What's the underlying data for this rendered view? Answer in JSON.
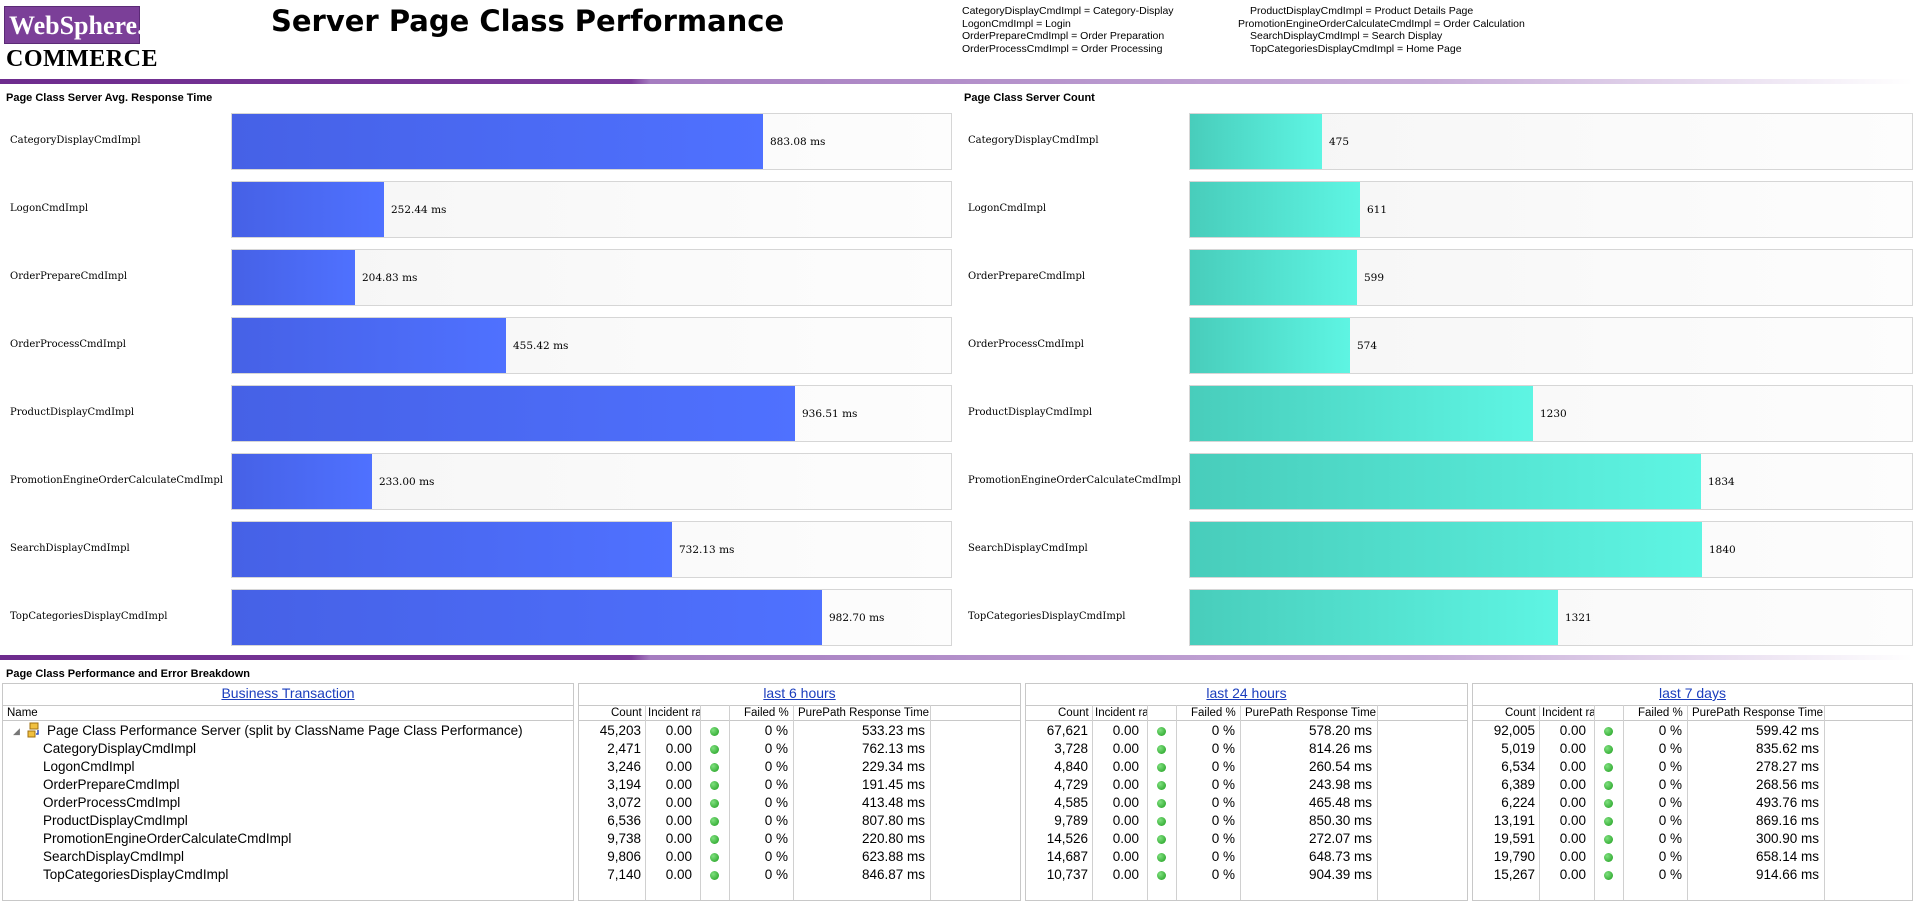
{
  "header": {
    "logo_top": "WebSphere.",
    "logo_bottom": "COMMERCE",
    "title": "Server Page Class Performance",
    "legend_col1": [
      "CategoryDisplayCmdImpl = Category-Display",
      "LogonCmdImpl = Login",
      "OrderPrepareCmdImpl = Order Preparation",
      "OrderProcessCmdImpl = Order Processing"
    ],
    "legend_col2": [
      "ProductDisplayCmdImpl = Product Details Page",
      "PromotionEngineOrderCalculateCmdImpl = Order Calculation",
      "SearchDisplayCmdImpl = Search Display",
      "TopCategoriesDisplayCmdImpl = Home Page"
    ]
  },
  "colors": {
    "brand_purple": "#7b3f98",
    "response_bar": "#4f71ff",
    "count_bar": "#5ef5e3",
    "status_ok": "#2aa52a",
    "link": "#1a3dbd"
  },
  "chart_data": [
    {
      "type": "bar",
      "orientation": "horizontal",
      "title": "Page Class Server Avg. Response Time",
      "categories": [
        "CategoryDisplayCmdImpl",
        "LogonCmdImpl",
        "OrderPrepareCmdImpl",
        "OrderProcessCmdImpl",
        "ProductDisplayCmdImpl",
        "PromotionEngineOrderCalculateCmdImpl",
        "SearchDisplayCmdImpl",
        "TopCategoriesDisplayCmdImpl"
      ],
      "values": [
        883.08,
        252.44,
        204.83,
        455.42,
        936.51,
        233.0,
        732.13,
        982.7
      ],
      "value_labels": [
        "883.08 ms",
        "252.44 ms",
        "204.83 ms",
        "455.42 ms",
        "936.51 ms",
        "233.00 ms",
        "732.13 ms",
        "982.70 ms"
      ],
      "xlim": [
        0,
        1200
      ],
      "grid": false
    },
    {
      "type": "bar",
      "orientation": "horizontal",
      "title": "Page Class Server Count",
      "categories": [
        "CategoryDisplayCmdImpl",
        "LogonCmdImpl",
        "OrderPrepareCmdImpl",
        "OrderProcessCmdImpl",
        "ProductDisplayCmdImpl",
        "PromotionEngineOrderCalculateCmdImpl",
        "SearchDisplayCmdImpl",
        "TopCategoriesDisplayCmdImpl"
      ],
      "values": [
        475,
        611,
        599,
        574,
        1230,
        1834,
        1840,
        1321
      ],
      "value_labels": [
        "475",
        "611",
        "599",
        "574",
        "1230",
        "1834",
        "1840",
        "1321"
      ],
      "xlim": [
        0,
        2600
      ],
      "grid": false
    }
  ],
  "table": {
    "title": "Page Class Performance and Error Breakdown",
    "name_header": "Business Transaction",
    "name_col": "Name",
    "periods": [
      "last 6 hours",
      "last 24 hours",
      "last 7 days"
    ],
    "metric_cols": [
      "Count",
      "Incident rat",
      "Failed %",
      "PurePath Response Time"
    ],
    "rows": [
      {
        "name": "Page Class Performance Server (split by ClassName Page Class Performance)",
        "root": true,
        "p": [
          [
            "45,203",
            "0.00",
            "0 %",
            "533.23 ms"
          ],
          [
            "67,621",
            "0.00",
            "0 %",
            "578.20 ms"
          ],
          [
            "92,005",
            "0.00",
            "0 %",
            "599.42 ms"
          ]
        ]
      },
      {
        "name": "CategoryDisplayCmdImpl",
        "p": [
          [
            "2,471",
            "0.00",
            "0 %",
            "762.13 ms"
          ],
          [
            "3,728",
            "0.00",
            "0 %",
            "814.26 ms"
          ],
          [
            "5,019",
            "0.00",
            "0 %",
            "835.62 ms"
          ]
        ]
      },
      {
        "name": "LogonCmdImpl",
        "p": [
          [
            "3,246",
            "0.00",
            "0 %",
            "229.34 ms"
          ],
          [
            "4,840",
            "0.00",
            "0 %",
            "260.54 ms"
          ],
          [
            "6,534",
            "0.00",
            "0 %",
            "278.27 ms"
          ]
        ]
      },
      {
        "name": "OrderPrepareCmdImpl",
        "p": [
          [
            "3,194",
            "0.00",
            "0 %",
            "191.45 ms"
          ],
          [
            "4,729",
            "0.00",
            "0 %",
            "243.98 ms"
          ],
          [
            "6,389",
            "0.00",
            "0 %",
            "268.56 ms"
          ]
        ]
      },
      {
        "name": "OrderProcessCmdImpl",
        "p": [
          [
            "3,072",
            "0.00",
            "0 %",
            "413.48 ms"
          ],
          [
            "4,585",
            "0.00",
            "0 %",
            "465.48 ms"
          ],
          [
            "6,224",
            "0.00",
            "0 %",
            "493.76 ms"
          ]
        ]
      },
      {
        "name": "ProductDisplayCmdImpl",
        "p": [
          [
            "6,536",
            "0.00",
            "0 %",
            "807.80 ms"
          ],
          [
            "9,789",
            "0.00",
            "0 %",
            "850.30 ms"
          ],
          [
            "13,191",
            "0.00",
            "0 %",
            "869.16 ms"
          ]
        ]
      },
      {
        "name": "PromotionEngineOrderCalculateCmdImpl",
        "p": [
          [
            "9,738",
            "0.00",
            "0 %",
            "220.80 ms"
          ],
          [
            "14,526",
            "0.00",
            "0 %",
            "272.07 ms"
          ],
          [
            "19,591",
            "0.00",
            "0 %",
            "300.90 ms"
          ]
        ]
      },
      {
        "name": "SearchDisplayCmdImpl",
        "p": [
          [
            "9,806",
            "0.00",
            "0 %",
            "623.88 ms"
          ],
          [
            "14,687",
            "0.00",
            "0 %",
            "648.73 ms"
          ],
          [
            "19,790",
            "0.00",
            "0 %",
            "658.14 ms"
          ]
        ]
      },
      {
        "name": "TopCategoriesDisplayCmdImpl",
        "p": [
          [
            "7,140",
            "0.00",
            "0 %",
            "846.87 ms"
          ],
          [
            "10,737",
            "0.00",
            "0 %",
            "904.39 ms"
          ],
          [
            "15,267",
            "0.00",
            "0 %",
            "914.66 ms"
          ]
        ]
      }
    ]
  }
}
